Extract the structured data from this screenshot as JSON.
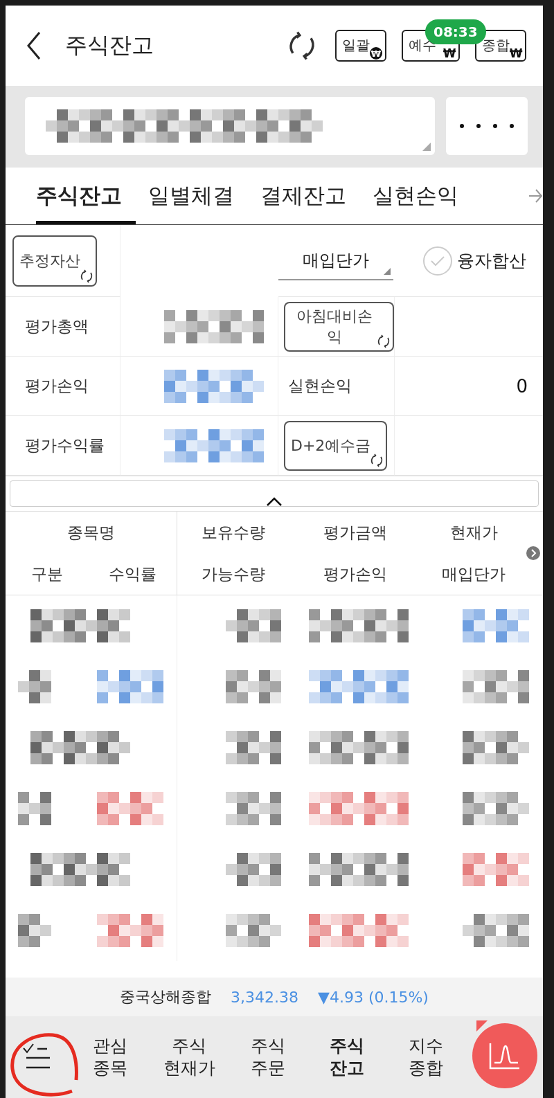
{
  "header": {
    "title": "주식잔고",
    "buttons": [
      {
        "label": "일괄",
        "badge": "₩",
        "kind": "filled"
      },
      {
        "label": "예수",
        "badge": "₩",
        "kind": "plain"
      },
      {
        "label": "종합",
        "badge": "₩",
        "kind": "plain"
      }
    ],
    "clock": "08:33"
  },
  "tabs": [
    {
      "label": "주식잔고",
      "selected": true
    },
    {
      "label": "일별체결",
      "selected": false
    },
    {
      "label": "결제잔고",
      "selected": false
    },
    {
      "label": "실현손익",
      "selected": false
    }
  ],
  "summary": {
    "estimate_button": "추정자산",
    "price_dropdown": "매입단가",
    "margin_checkbox": {
      "label": "융자합산",
      "checked": false
    },
    "left": [
      {
        "label": "평가총액",
        "color": "#8a8a8a"
      },
      {
        "label": "평가손익",
        "color": "#6f9fe0"
      },
      {
        "label": "평가수익률",
        "color": "#6f9fe0"
      }
    ],
    "right": [
      {
        "kind": "button",
        "label": "아침대비손익"
      },
      {
        "kind": "text",
        "label": "실현손익",
        "value": "0"
      },
      {
        "kind": "button",
        "label": "D+2예수금"
      }
    ]
  },
  "table": {
    "columns_top": [
      "종목명",
      "보유수량",
      "평가금액",
      "현재가"
    ],
    "columns_bottom": [
      "구분",
      "수익률",
      "가능수량",
      "평가손익",
      "매입단가"
    ],
    "holdings": [
      {
        "color": "#6f9fe0"
      },
      {
        "color": "#e57e7e"
      },
      {
        "color": "#e57e7e"
      }
    ]
  },
  "ticker": {
    "name": "중국상해종합",
    "value": "3,342.38",
    "change": "▼4.93 (0.15%)",
    "color": "#4a90e2"
  },
  "nav": [
    {
      "label": "관심\n종목",
      "selected": false
    },
    {
      "label": "주식\n현재가",
      "selected": false
    },
    {
      "label": "주식\n주문",
      "selected": false
    },
    {
      "label": "주식\n잔고",
      "selected": true
    },
    {
      "label": "지수\n종합",
      "selected": false
    }
  ]
}
